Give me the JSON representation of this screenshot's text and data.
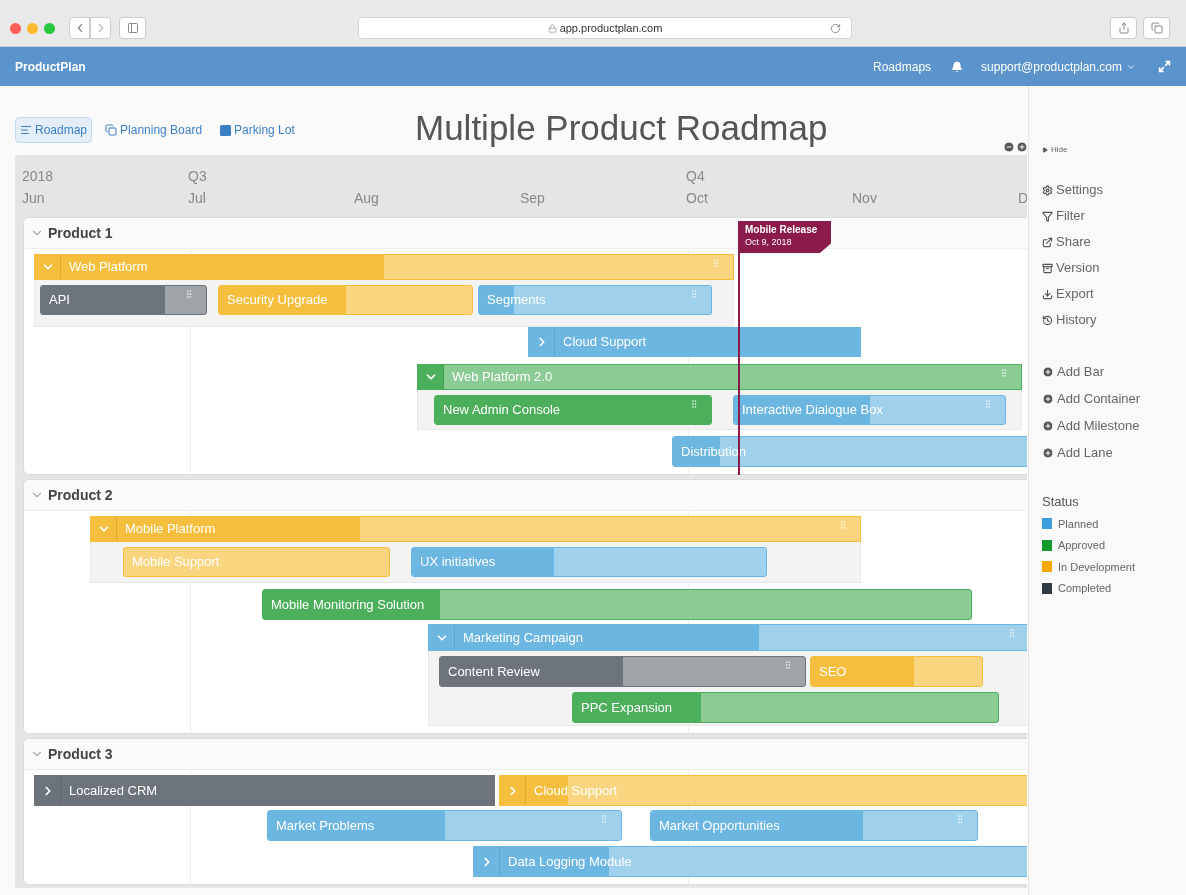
{
  "browser": {
    "url": "app.productplan.com"
  },
  "navbar": {
    "brand": "ProductPlan",
    "links": [
      "Roadmaps"
    ],
    "account": "support@productplan.com"
  },
  "view_tabs": [
    {
      "label": "Roadmap",
      "selected": true
    },
    {
      "label": "Planning Board",
      "selected": false
    },
    {
      "label": "Parking Lot",
      "selected": false
    }
  ],
  "title": "Multiple Product Roadmap",
  "timeline": [
    {
      "month": "Jun",
      "quarter": "2018"
    },
    {
      "month": "Jul",
      "quarter": "Q3"
    },
    {
      "month": "Aug"
    },
    {
      "month": "Sep"
    },
    {
      "month": "Oct",
      "quarter": "Q4"
    },
    {
      "month": "Nov"
    },
    {
      "month": "D"
    }
  ],
  "lanes": [
    {
      "name": "Product 1",
      "expanded": true,
      "milestones": [
        {
          "name": "Mobile Release",
          "date": "Oct 9, 2018"
        }
      ],
      "items": [
        {
          "kind": "container",
          "label": "Web Platform",
          "color": "#f5be3c",
          "level": 0.5,
          "expanded": true,
          "handle": true,
          "children": [
            {
              "kind": "bar",
              "label": "API",
              "color": "#6c737a",
              "level": 0.75,
              "handle": true
            },
            {
              "kind": "bar",
              "label": "Security Upgrade",
              "color": "#f5be3c",
              "level": 0.5,
              "handle": false
            },
            {
              "kind": "bar",
              "label": "Segments",
              "color": "#6bb7e2",
              "level": 0.15,
              "handle": true
            }
          ]
        },
        {
          "kind": "container",
          "label": "Cloud Support",
          "color": "#6bb7e2",
          "level": 1,
          "expanded": false,
          "handle": false
        },
        {
          "kind": "container",
          "label": "Web Platform 2.0",
          "color": "#4caf5b",
          "level": 0,
          "expanded": true,
          "handle": true,
          "children": [
            {
              "kind": "bar",
              "label": "New Admin Console",
              "color": "#4caf5b",
              "level": 1,
              "handle": true
            },
            {
              "kind": "bar",
              "label": "Interactive Dialogue Box",
              "color": "#6bb7e2",
              "level": 0.5,
              "handle": true
            }
          ]
        },
        {
          "kind": "bar",
          "label": "Distribution",
          "color": "#6bb7e2",
          "level": 0.12,
          "handle": false
        }
      ]
    },
    {
      "name": "Product 2",
      "expanded": true,
      "items": [
        {
          "kind": "container",
          "label": "Mobile Platform",
          "color": "#f5be3c",
          "level": 0.35,
          "expanded": true,
          "handle": true,
          "children": [
            {
              "kind": "bar",
              "label": "Mobile Support",
              "color": "#f5be3c",
              "handle": false
            },
            {
              "kind": "bar",
              "label": "UX initiatives",
              "color": "#6bb7e2",
              "level": 0.4,
              "handle": false
            }
          ]
        },
        {
          "kind": "bar",
          "label": "Mobile Monitoring Solution",
          "color": "#4caf5b",
          "level": 0.25,
          "handle": false
        },
        {
          "kind": "container",
          "label": "Marketing Campaign",
          "color": "#6bb7e2",
          "level": 0.55,
          "expanded": true,
          "handle": true,
          "children": [
            {
              "kind": "bar",
              "label": "Content Review",
              "color": "#6c737a",
              "level": 0.5,
              "handle": true
            },
            {
              "kind": "bar",
              "label": "SEO",
              "color": "#f5be3c",
              "level": 0.6,
              "handle": false
            },
            {
              "kind": "bar",
              "label": "PPC Expansion",
              "color": "#4caf5b",
              "level": 0.3,
              "handle": false
            }
          ]
        }
      ]
    },
    {
      "name": "Product 3",
      "expanded": true,
      "items": [
        {
          "kind": "container",
          "label": "Localized CRM",
          "color": "#6c737a",
          "level": 1,
          "expanded": false,
          "handle": false
        },
        {
          "kind": "container",
          "label": "Cloud Support",
          "color": "#f5be3c",
          "level": 0.12,
          "expanded": false,
          "handle": false
        },
        {
          "kind": "bar",
          "label": "Market Problems",
          "color": "#6bb7e2",
          "level": 0.5,
          "handle": true
        },
        {
          "kind": "bar",
          "label": "Market Opportunities",
          "color": "#6bb7e2",
          "level": 0.65,
          "handle": true
        },
        {
          "kind": "container",
          "label": "Data Logging Module",
          "color": "#6bb7e2",
          "level": 0.23,
          "expanded": false,
          "handle": false
        }
      ]
    }
  ],
  "sidebar": {
    "hide": "Hide",
    "actions": [
      "Settings",
      "Filter",
      "Share",
      "Version",
      "Export",
      "History"
    ],
    "add_actions": [
      "Add Bar",
      "Add Container",
      "Add Milestone",
      "Add Lane"
    ],
    "legend": {
      "title": "Status",
      "items": [
        {
          "label": "Planned",
          "color": "#3d9ddc"
        },
        {
          "label": "Approved",
          "color": "#139a2c"
        },
        {
          "label": "In Development",
          "color": "#f5a800"
        },
        {
          "label": "Completed",
          "color": "#2f3a45"
        }
      ]
    }
  }
}
